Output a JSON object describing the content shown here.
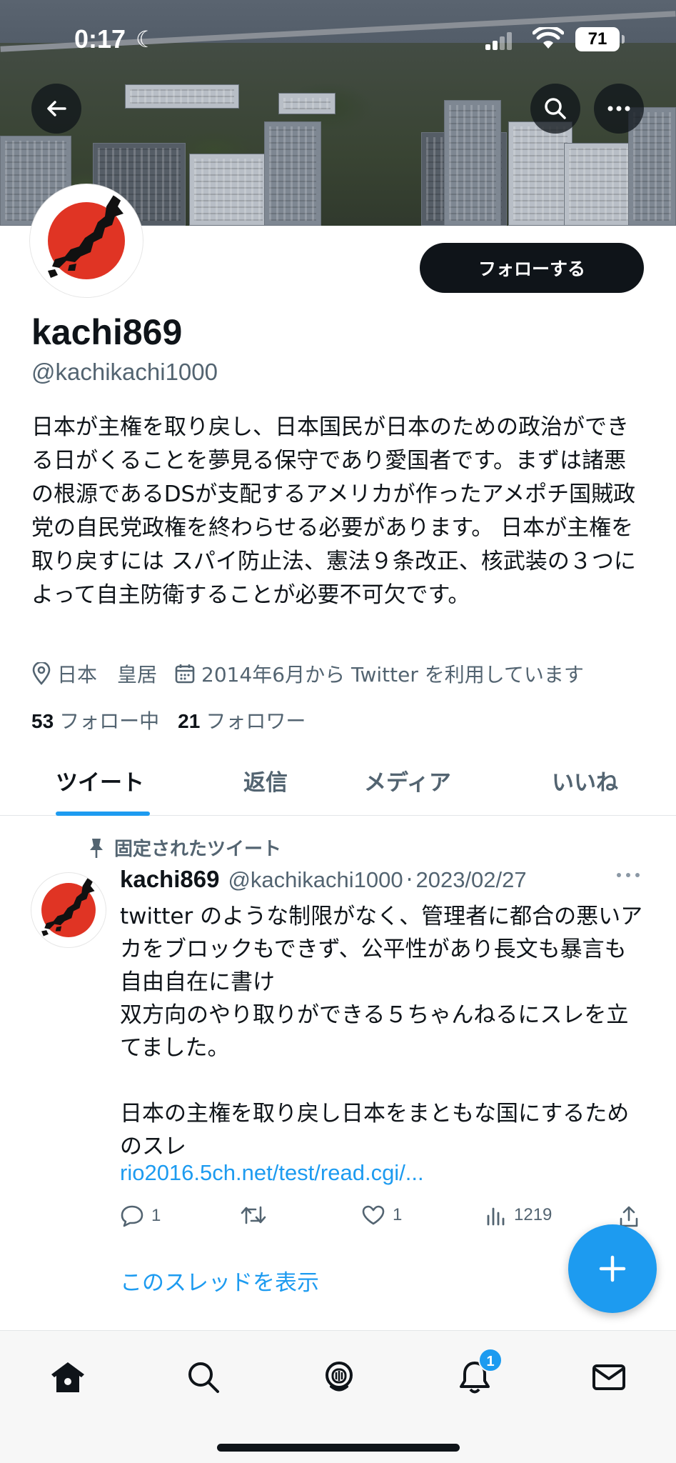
{
  "status_bar": {
    "time": "0:17",
    "battery": "71"
  },
  "profile": {
    "follow_label": "フォローする",
    "display_name": "kachi869",
    "handle": "@kachikachi1000",
    "bio": "日本が主権を取り戻し、日本国民が日本のための政治ができる日がくることを夢見る保守であり愛国者です。まずは諸悪の根源であるDSが支配するアメリカが作ったアメポチ国賊政党の自民党政権を終わらせる必要があります。 日本が主権を取り戻すには スパイ防止法、憲法９条改正、核武装の３つによって自主防衛することが必要不可欠です。",
    "location": "日本　皇居",
    "joined": "2014年6月から Twitter を利用しています",
    "following_count": "53",
    "following_label": "フォロー中",
    "followers_count": "21",
    "followers_label": "フォロワー"
  },
  "tabs": [
    {
      "label": "ツイート",
      "active": true
    },
    {
      "label": "返信",
      "active": false
    },
    {
      "label": "メディア",
      "active": false
    },
    {
      "label": "いいね",
      "active": false
    }
  ],
  "pinned_tweet": {
    "pinned_label": "固定されたツイート",
    "name": "kachi869",
    "handle": "@kachikachi1000",
    "separator": "·",
    "date": "2023/02/27",
    "text": "twitter のような制限がなく、管理者に都合の悪いアカをブロックもできず、公平性があり長文も暴言も自由自在に書け\n双方向のやり取りができる５ちゃんねるにスレを立てました。\n\n日本の主権を取り戻し日本をまともな国にするためのスレ",
    "link": "rio2016.5ch.net/test/read.cgi/...",
    "replies": "1",
    "retweets": "",
    "likes": "1",
    "views": "1219",
    "thread_link": "このスレッドを表示"
  },
  "nav": {
    "notifications_badge": "1",
    "accent": "#1d9bf0"
  }
}
